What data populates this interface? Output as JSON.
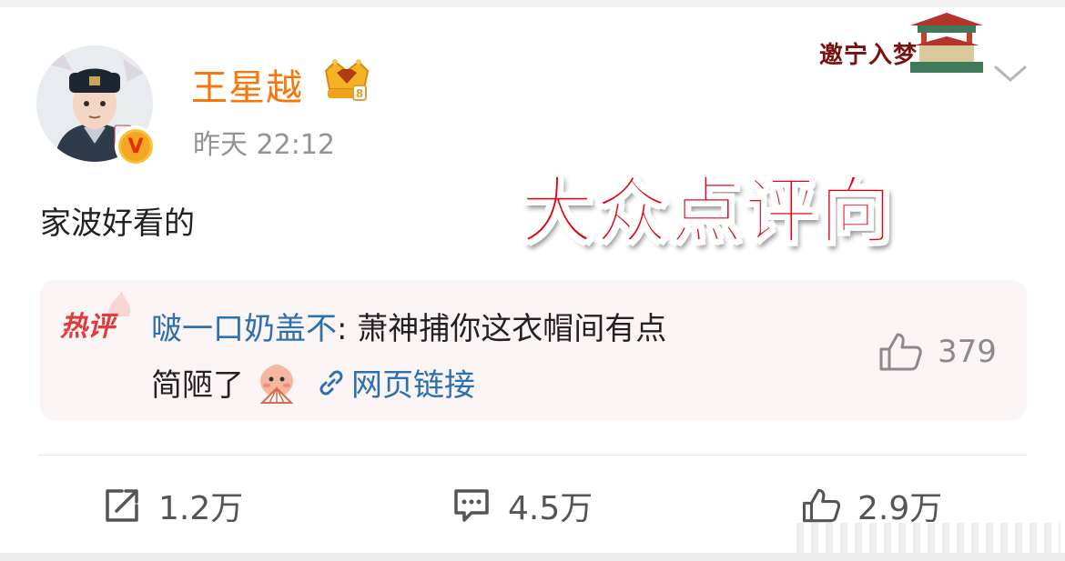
{
  "post": {
    "username": "王星越",
    "timestamp": "昨天 22:12",
    "text": "家波好看的",
    "overlay_title": "大众点评向",
    "logo_text": "邀宁入梦"
  },
  "hot_comment": {
    "tag": "热评",
    "author": "啵一口奶盖不",
    "separator": ": ",
    "text_line1": "萧神捕你这衣帽间有点",
    "text_line2": "简陋了",
    "link_label": "网页链接",
    "like_count": "379"
  },
  "actions": {
    "repost_count": "1.2万",
    "comment_count": "4.5万",
    "like_count": "2.9万"
  },
  "colors": {
    "username": "#f7760a",
    "link": "#2d6fb0",
    "hot_tag": "#e03a3a",
    "overlay": "#e60012",
    "card_bg": "#fbf4f4"
  },
  "icons": [
    "avatar",
    "verified-badge-icon",
    "vip-crown-icon",
    "chevron-down-icon",
    "hot-comment-icon",
    "emoji-icon",
    "link-icon",
    "thumbs-up-icon",
    "repost-icon",
    "comment-icon"
  ]
}
